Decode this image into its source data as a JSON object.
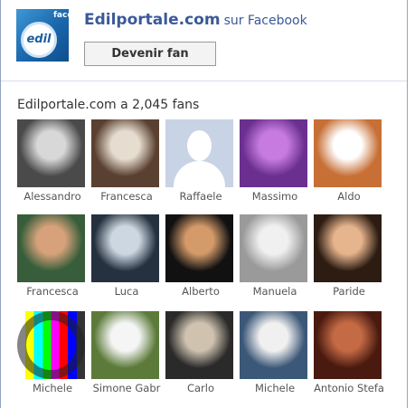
{
  "page": {
    "title_link": "Edilportale.com",
    "title_suffix": "sur Facebook",
    "fan_button": "Devenir fan",
    "fan_count_text": "Edilportale.com a 2,045 fans",
    "logo": {
      "text": "edil",
      "corner_text": "face"
    }
  },
  "fans": [
    {
      "name": "Alessandro",
      "photo_colors": [
        "#4a4a4a",
        "#d8d8d8"
      ]
    },
    {
      "name": "Francesca",
      "photo_colors": [
        "#5a4030",
        "#e6ddd0"
      ]
    },
    {
      "name": "Raffaele",
      "photo_colors": [
        "#c8d3e5",
        "#ffffff"
      ]
    },
    {
      "name": "Massimo",
      "photo_colors": [
        "#6a2f8f",
        "#c77be0"
      ]
    },
    {
      "name": "Aldo",
      "photo_colors": [
        "#c76f35",
        "#ffffff"
      ]
    },
    {
      "name": "Francesca",
      "photo_colors": [
        "#375d3a",
        "#d7a27b"
      ]
    },
    {
      "name": "Luca",
      "photo_colors": [
        "#25313f",
        "#cdd7e2"
      ]
    },
    {
      "name": "Alberto",
      "photo_colors": [
        "#111111",
        "#d49a6a"
      ]
    },
    {
      "name": "Manuela",
      "photo_colors": [
        "#9a9a9a",
        "#f0f0f0"
      ]
    },
    {
      "name": "Paride",
      "photo_colors": [
        "#2c1c12",
        "#e6b48d"
      ]
    },
    {
      "name": "Michele",
      "photo_colors": [
        "#333333",
        "#ffffff"
      ]
    },
    {
      "name": "Simone Gabr",
      "photo_colors": [
        "#5c7b3a",
        "#f5f5f5"
      ]
    },
    {
      "name": "Carlo",
      "photo_colors": [
        "#2a2a2a",
        "#cfc3b0"
      ]
    },
    {
      "name": "Michele",
      "photo_colors": [
        "#3c5878",
        "#f0f0f0"
      ]
    },
    {
      "name": "Antonio Stefa",
      "photo_colors": [
        "#4a1a10",
        "#c46a45"
      ]
    }
  ]
}
